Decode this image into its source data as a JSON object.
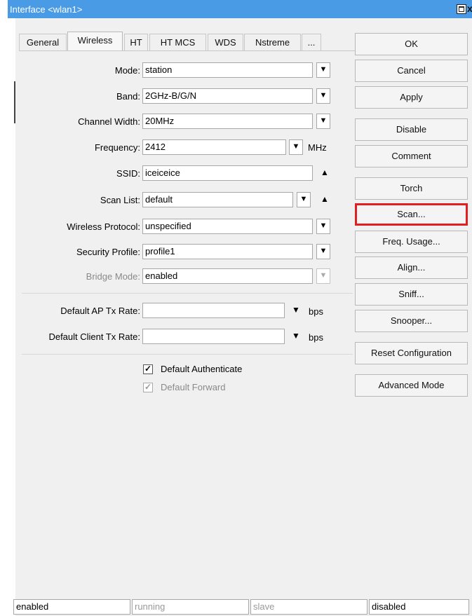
{
  "window": {
    "title": "Interface <wlan1>"
  },
  "tabs": [
    {
      "label": "General"
    },
    {
      "label": "Wireless",
      "active": true
    },
    {
      "label": "HT"
    },
    {
      "label": "HT MCS"
    },
    {
      "label": "WDS"
    },
    {
      "label": "Nstreme"
    },
    {
      "label": "..."
    }
  ],
  "form": {
    "mode": {
      "label": "Mode:",
      "value": "station"
    },
    "band": {
      "label": "Band:",
      "value": "2GHz-B/G/N"
    },
    "channel_width": {
      "label": "Channel Width:",
      "value": "20MHz"
    },
    "frequency": {
      "label": "Frequency:",
      "value": "2412",
      "unit": "MHz"
    },
    "ssid": {
      "label": "SSID:",
      "value": "iceiceice"
    },
    "scan_list": {
      "label": "Scan List:",
      "value": "default"
    },
    "wireless_protocol": {
      "label": "Wireless Protocol:",
      "value": "unspecified"
    },
    "security_profile": {
      "label": "Security Profile:",
      "value": "profile1"
    },
    "bridge_mode": {
      "label": "Bridge Mode:",
      "value": "enabled"
    },
    "default_ap_tx_rate": {
      "label": "Default AP Tx Rate:",
      "value": "",
      "unit": "bps"
    },
    "default_client_tx_rate": {
      "label": "Default Client Tx Rate:",
      "value": "",
      "unit": "bps"
    },
    "default_authenticate": {
      "label": "Default Authenticate",
      "checked": true
    },
    "default_forward": {
      "label": "Default Forward",
      "checked": true,
      "disabled": true
    }
  },
  "buttons": {
    "ok": "OK",
    "cancel": "Cancel",
    "apply": "Apply",
    "disable": "Disable",
    "comment": "Comment",
    "torch": "Torch",
    "scan": "Scan...",
    "freq_usage": "Freq. Usage...",
    "align": "Align...",
    "sniff": "Sniff...",
    "snooper": "Snooper...",
    "reset_configuration": "Reset Configuration",
    "advanced_mode": "Advanced Mode"
  },
  "statusbar": {
    "enabled": "enabled",
    "running": "running",
    "slave": "slave",
    "disabled": "disabled"
  },
  "colors": {
    "titlebar": "#4a9be6",
    "highlight": "#e02020"
  },
  "icons": {
    "dropdown": "dropdown-arrow-icon",
    "collapse": "up-arrow-icon",
    "checkbox": "checkmark-icon"
  }
}
